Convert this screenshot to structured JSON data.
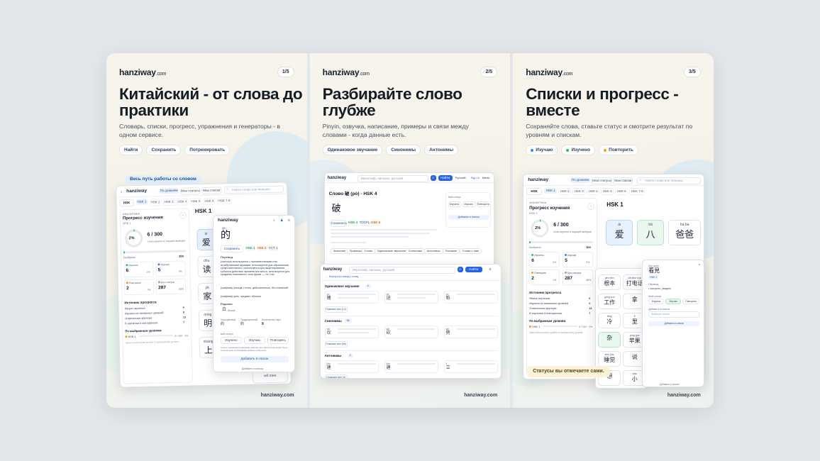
{
  "brand": {
    "name": "hanziway",
    "tld": ".com",
    "site": "hanziway.com"
  },
  "colors": {
    "accent": "#2f5fb3",
    "brand_blue": "#2563eb",
    "green": "#22c55e",
    "amber": "#f59e0b",
    "bg": "#e3e6ea"
  },
  "slides": [
    {
      "pager": "1/5",
      "title": "Китайский - от слова до практики",
      "subtitle": "Словарь, списки, прогресс, упражнения и генераторы - в одном сервисе.",
      "chips": [
        "Найти",
        "Сохранить",
        "Потренировать"
      ],
      "callout": "Весь путь работы со словом",
      "app": {
        "nav": [
          "По уровням",
          "Мои статусы",
          "Мои списки"
        ],
        "search": "Найти слово или пиньинь",
        "level": "HSK",
        "levels": [
          "HSK 1",
          "HSK 2",
          "HSK 3",
          "HSK 4",
          "HSK 5",
          "HSK 6",
          "HSK 7-9"
        ],
        "analytics": "АНАЛИТИКА",
        "progress_title": "Прогресс изучения",
        "progress_sub": "HSK 1",
        "percent": "2%",
        "count": "6 / 300",
        "count_sub": "слов изучено в текущей выборке",
        "selected": "Выбрано",
        "selected_val": "300",
        "stats": [
          {
            "label": "Изучено",
            "value": "6",
            "pct": "2%"
          },
          {
            "label": "Изучаю",
            "value": "5",
            "pct": "2%"
          },
          {
            "label": "Повторить",
            "value": "2",
            "pct": "1%"
          },
          {
            "label": "Без статуса",
            "value": "287",
            "pct": "96%"
          }
        ],
        "sources_title": "Источник прогресса",
        "sources": [
          [
            "Явные изучения",
            "6"
          ],
          [
            "Изучено из связанных уровней",
            "0"
          ],
          [
            "Отмеченные вручную",
            "13"
          ],
          [
            "В изучении и повторениях",
            "7"
          ]
        ],
        "by_levels": "По выбранным уровням",
        "bar_label": "HSK 1",
        "bar_val": "6 / 300 · 2%",
        "footnote": "Одна полоса внизу уровня по выбранному уровню.",
        "hsk_heading": "HSK 1",
        "word_tiles": [
          {
            "py": "ài",
            "hz": "爱"
          },
          {
            "py": "dōu",
            "hz": "读"
          },
          {
            "py": "jiā",
            "hz": "家"
          },
          {
            "py": "míng",
            "hz": "明"
          },
          {
            "py": "shàng",
            "hz": "上"
          },
          {
            "py": "wǒ men",
            "hz": "我们"
          }
        ]
      },
      "popup": {
        "pinyin": "de",
        "hanzi": "的",
        "save": "Сохранить",
        "tags": [
          "HSK 1",
          "HSK 2",
          "HSK 3",
          "YCT 1"
        ],
        "section": "Перевод",
        "defs": [
          "(частица) используется с прилагательными или атрибутивными фразами; используется для образования существительного, используется для акцентирования субъекта действия, времени или места, используется для придания позитивного тона фразе — «я / ты»",
          "(графема) (иногда ) точно, действительно, без сомнений",
          "(графема) цель, предмет, яблочко"
        ],
        "radical_label": "Радикал",
        "radical": "白",
        "radical_sub": "белый",
        "traditional_label": "Упрощённый",
        "traditional": "的",
        "traditional2_label": "Традиционный",
        "traditional2": "的",
        "strokes_label": "Количество черт",
        "strokes": "8",
        "status_label": "мой статус",
        "statuses": [
          "Изучено",
          "Изучаю",
          "Повторить"
        ],
        "note": "Статус сохраняется как ваша заметка. Его присутствие может быть полезно для отслеживания вашего прогресса.",
        "add": "Добавить в список",
        "bottom": "Добавить в список"
      }
    },
    {
      "pager": "2/5",
      "title": "Разбирайте слово глубже",
      "subtitle": "Pinyin, озвучка, написание, примеры и связи между словами - когда данные есть.",
      "chips": [
        "Одинаковое звучание",
        "Синонимы",
        "Антонимы"
      ],
      "app": {
        "search": "Иероглиф, пиньинь, русский",
        "go": "Найти",
        "login": "Sign in",
        "lang": "Русский",
        "menu": "Меню",
        "word_title": "Слово 破 (pò) - HSK 4",
        "hanzi": "破",
        "save": "Сохранить",
        "tags": [
          "HSK 4",
          "TOCFL 3",
          "HSK 5",
          "YCT 1"
        ],
        "side_title": "Мой статус",
        "side_btns": [
          "Изучено",
          "Изучаю",
          "Повторить"
        ],
        "side_add": "Добавить в список",
        "tabs": [
          "Значение",
          "Примеры",
          "Слово",
          "Одинаковое звучание",
          "Синонимы",
          "Антонимы",
          "Похожие",
          "Слова с ним",
          "Предложения",
          "Порядок черт"
        ]
      },
      "panel": {
        "search": "Иероглиф, пиньинь, русский",
        "go": "Найти",
        "back": "← Вернуться назад к слову",
        "sections": [
          {
            "title": "Одинаковое звучание",
            "badge": "4",
            "rows": [
              [
                "pò",
                "魄"
              ],
              [
                "pò",
                "迫"
              ],
              [
                "pò",
                "粕"
              ]
            ],
            "more": "Показать все (12)"
          },
          {
            "title": "Синонимы",
            "badge": "56",
            "rows": [
              [
                "kǎi",
                "坎"
              ],
              [
                "kǎi",
                "砍"
              ],
              [
                "kǎi",
                "劈"
              ]
            ],
            "more": "Показать все (56)"
          },
          {
            "title": "Антонимы",
            "badge": "4",
            "rows": [
              [
                "jiàn",
                "建"
              ],
              [
                "jiàn",
                "建"
              ],
              [
                "lì",
                "立"
              ]
            ],
            "more": "Показать все (4)"
          }
        ]
      }
    },
    {
      "pager": "3/5",
      "title": "Списки и прогресс - вместе",
      "subtitle": "Сохраняйте слова, ставьте статус и смотрите результат по уровням и спискам.",
      "chips": [
        "Изучаю",
        "Изучено",
        "Повторить"
      ],
      "chip_colors": [
        "#3b82f6",
        "#22c55e",
        "#f59e0b"
      ],
      "callout": "Статусы вы отмечаете сами.",
      "app": {
        "nav": [
          "По уровням",
          "Мои статусы",
          "Мои списки"
        ],
        "search": "Найти слово или пиньинь",
        "level": "HSK",
        "levels": [
          "HSK 1",
          "HSK 2",
          "HSK 3",
          "HSK 4",
          "HSK 5",
          "HSK 6",
          "HSK 7-9"
        ],
        "analytics": "АНАЛИТИКА",
        "progress_title": "Прогресс изучения",
        "progress_sub": "HSK 1",
        "percent": "2%",
        "count": "6 / 300",
        "count_sub": "слов изучено в текущей выборке",
        "selected": "Выбрано",
        "selected_val": "300",
        "stats": [
          {
            "label": "Изучено",
            "value": "6",
            "pct": "2%"
          },
          {
            "label": "Изучаю",
            "value": "5",
            "pct": "2%"
          },
          {
            "label": "Повторить",
            "value": "2",
            "pct": "1%"
          },
          {
            "label": "Без статуса",
            "value": "287",
            "pct": "96%"
          }
        ],
        "sources_title": "Источник прогресса",
        "sources": [
          [
            "Явные изучения",
            "6"
          ],
          [
            "Изучено из связанных уровней",
            "0"
          ],
          [
            "Отмеченные вручную",
            "13"
          ],
          [
            "В изучении и повторениях",
            "7"
          ]
        ],
        "by_levels": "По выбранным уровням",
        "bar_label": "HSK 1",
        "bar_val": "6 / 300 · 2%",
        "footnote": "Одна полоса внизу уровня по выбранному уровню.",
        "hsk_heading": "HSK 1",
        "word_tiles": [
          {
            "py": "ài",
            "hz": "爱"
          },
          {
            "py": "bā",
            "hz": "八"
          },
          {
            "py": "bà ba",
            "hz": "爸爸"
          }
        ]
      },
      "grid": [
        {
          "py": "gēn běn",
          "hz": "根本"
        },
        {
          "py": "dǎ diàn huà",
          "hz": "打电话"
        },
        {
          "py": "gōng zuò",
          "hz": "工作"
        },
        {
          "py": "",
          "hz": "拿"
        },
        {
          "py": "lěng",
          "hz": "冷"
        },
        {
          "py": "lǐ",
          "hz": "里"
        },
        {
          "py": "",
          "hz": "杂"
        },
        {
          "py": "píng guǒ",
          "hz": "苹果"
        },
        {
          "py": "shuì jiào",
          "hz": "睡觉"
        },
        {
          "py": "",
          "hz": "说"
        },
        {
          "py": "",
          "hz": "想"
        },
        {
          "py": "xiǎo",
          "hz": "小"
        }
      ],
      "popup": {
        "pinyin": "bào guǎn",
        "hanzi": "看見",
        "tag": "HSK 1",
        "section": "Перевод",
        "def": "• смотреть, увидеть",
        "status_label": "Мой статус",
        "statuses": [
          "Изучено",
          "Изучаю",
          "Повторить"
        ],
        "list_label": "Добавить в список",
        "list_placeholder": "Выберите список",
        "add": "Добавить в список",
        "bottom": "Добавить в список"
      }
    }
  ]
}
